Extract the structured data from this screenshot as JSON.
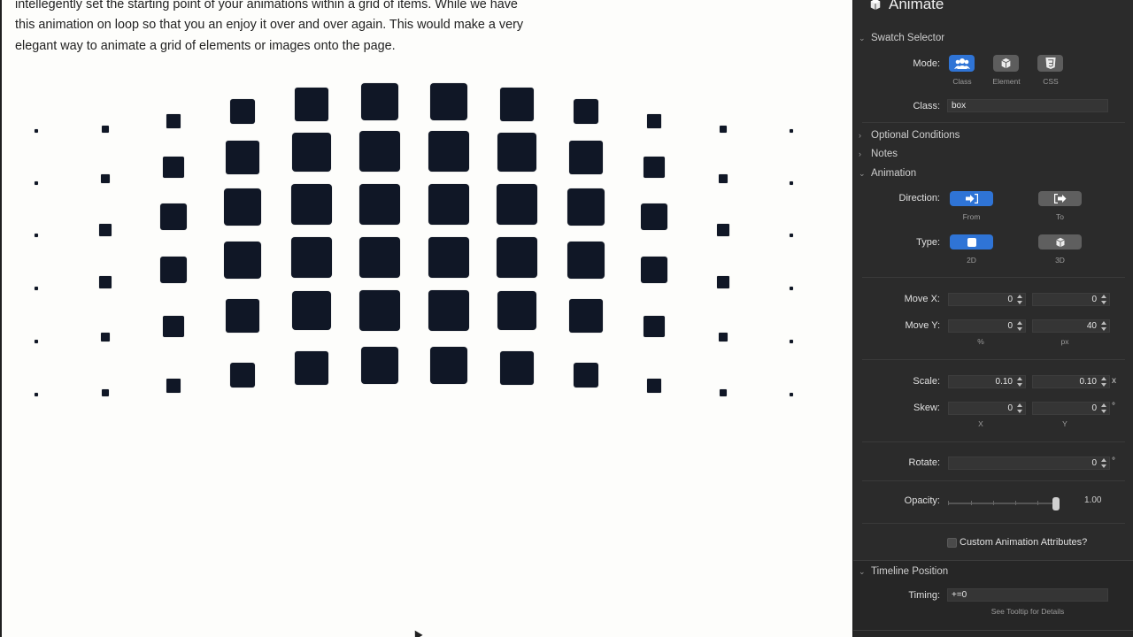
{
  "content": {
    "intro_lines": [
      "intellegently set the starting point of your animations within a grid of items. While we have",
      "this animation on loop so that you an enjoy it over and over again. This would make a very",
      "elegant way to animate a grid of elements or images onto the page."
    ],
    "grid": {
      "columns": 12,
      "rows": 6,
      "box_color": "#101726"
    }
  },
  "panel": {
    "title": "Animate",
    "icon": "cube-icon",
    "swatch_selector": {
      "heading": "Swatch Selector",
      "mode_label": "Mode:",
      "modes": [
        {
          "caption": "Class",
          "icon": "users-icon",
          "active": true
        },
        {
          "caption": "Element",
          "icon": "cube-icon",
          "active": false
        },
        {
          "caption": "CSS",
          "icon": "css3-icon",
          "active": false
        }
      ],
      "class_label": "Class:",
      "class_value": "box"
    },
    "sections": {
      "optional_conditions": "Optional Conditions",
      "notes": "Notes",
      "animation": "Animation",
      "timeline_position": "Timeline Position"
    },
    "animation": {
      "direction_label": "Direction:",
      "direction": [
        {
          "caption": "From",
          "icon": "arrow-in-icon",
          "active": true
        },
        {
          "caption": "To",
          "icon": "arrow-out-icon",
          "active": false
        }
      ],
      "type_label": "Type:",
      "types": [
        {
          "caption": "2D",
          "icon": "square-icon",
          "active": true
        },
        {
          "caption": "3D",
          "icon": "cube-icon",
          "active": false
        }
      ],
      "move_x_label": "Move X:",
      "move_x": [
        "0",
        "0"
      ],
      "move_y_label": "Move Y:",
      "move_y": [
        "0",
        "40"
      ],
      "move_units": [
        "%",
        "px"
      ],
      "scale_label": "Scale:",
      "scale": [
        "0.10",
        "0.10"
      ],
      "scale_unit": "x",
      "skew_label": "Skew:",
      "skew": [
        "0",
        "0"
      ],
      "skew_unit": "°",
      "skew_axes": [
        "X",
        "Y"
      ],
      "rotate_label": "Rotate:",
      "rotate": "0",
      "rotate_unit": "°",
      "opacity_label": "Opacity:",
      "opacity": "1.00",
      "opacity_level": 1.0,
      "custom_attr_label": "Custom Animation Attributes?"
    },
    "timeline": {
      "timing_label": "Timing:",
      "timing_value": "+=0",
      "hint": "See Tooltip for Details"
    },
    "colors": {
      "accent": "#2f74d6",
      "panel_bg": "#2b2b2b"
    }
  }
}
